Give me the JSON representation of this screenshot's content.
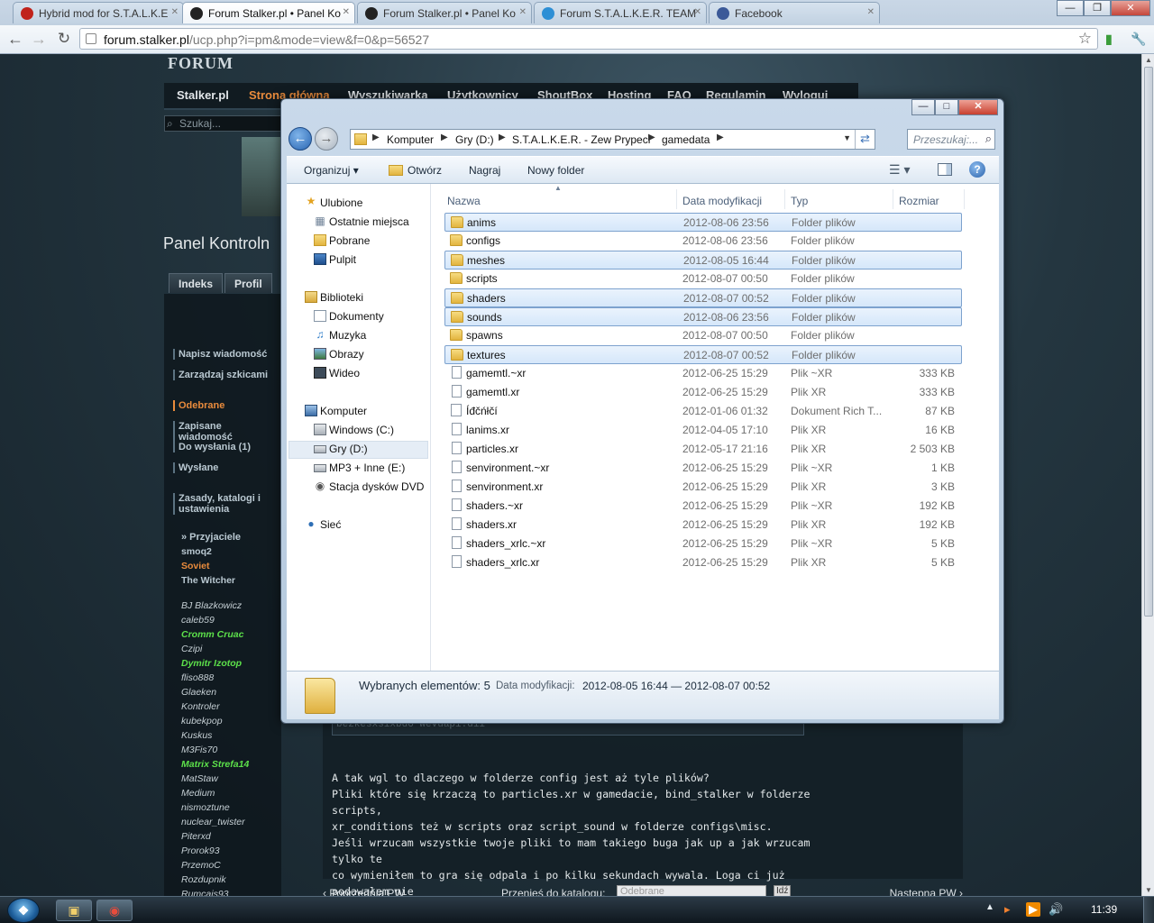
{
  "browser": {
    "tabs": [
      {
        "title": "Hybrid mod for S.T.A.L.K.E",
        "icon": "opera-icon"
      },
      {
        "title": "Forum Stalker.pl • Panel Ko",
        "icon": "radiation-icon",
        "active": true
      },
      {
        "title": "Forum Stalker.pl • Panel Ko",
        "icon": "radiation-icon"
      },
      {
        "title": "Forum S.T.A.L.K.E.R. TEAM",
        "icon": "twitter-bird-icon"
      },
      {
        "title": "Facebook",
        "icon": "facebook-icon"
      }
    ],
    "url_domain": "forum.stalker.pl",
    "url_path": "/ucp.php?i=pm&mode=view&f=0&p=56527"
  },
  "forum": {
    "logo": "FORUM",
    "nav": [
      "Stalker.pl",
      "Strona główna",
      "Wyszukiwarka",
      "Użytkownicy",
      "ShoutBox",
      "Hosting",
      "FAQ",
      "Regulamin",
      "Wyloguj"
    ],
    "search_placeholder": "Szukaj...",
    "panel_title": "Panel Kontroln",
    "tabs": [
      "Indeks",
      "Profil"
    ],
    "menu": [
      "Napisz wiadomość",
      "Zarządzaj szkicami",
      "Odebrane",
      "Zapisane wiadomość",
      "Do wysłania (1)",
      "Wysłane",
      "Zasady, katalogi i ustawienia"
    ],
    "friends_header": "» Przyjaciele",
    "friends_top": [
      "smoq2",
      "Soviet",
      "The Witcher"
    ],
    "friends": [
      "BJ Blazkowicz",
      "caleb59",
      "Cromm Cruac",
      "Czipi",
      "Dymitr Izotop",
      "fliso888",
      "Glaeken",
      "Kontroler",
      "kubekpop",
      "Kuskus",
      "M3Fis70",
      "Matrix Strefa14",
      "MatStaw",
      "Medium",
      "nismoztune",
      "nuclear_twister",
      "Piterxd",
      "Prorok93",
      "PrzemoC",
      "Rozdupnik",
      "Rumcajs93"
    ],
    "code_snippet": "bezkesxsixbdo wevuapi.dii",
    "post_lines": [
      "A tak wgl to dlaczego w folderze config jest aż tyle plików?",
      "Pliki które się krzaczą to particles.xr w gamedacie, bind_stalker w folderze scripts,",
      "xr_conditions też w scripts oraz script_sound w folderze configs\\misc.",
      "Jeśli wrzucam wszystkie twoje pliki to mam takiego buga jak up a jak wrzucam tylko te",
      "co wymieniłem to gra się odpala i po kilku sekundach wywala. Loga ci już podawałem nie",
      "mamm go teraz bo aktualnie wywala mi błąd z dźwiękiem broni."
    ],
    "bottom_prev": "‹ Poprzednia PW",
    "bottom_move": "Przenieś do katalogu:",
    "bottom_select": "Odebrane",
    "bottom_go": "Idź",
    "bottom_next": "Następna PW ›"
  },
  "explorer": {
    "breadcrumbs": [
      "Komputer",
      "Gry (D:)",
      "S.T.A.L.K.E.R. - Zew Prypeci",
      "gamedata"
    ],
    "search_placeholder": "Przeszukaj:...",
    "commands": {
      "organize": "Organizuj",
      "open": "Otwórz",
      "burn": "Nagraj",
      "new_folder": "Nowy folder"
    },
    "nav": {
      "favorites": "Ulubione",
      "fav_items": [
        "Ostatnie miejsca",
        "Pobrane",
        "Pulpit"
      ],
      "libraries": "Biblioteki",
      "lib_items": [
        "Dokumenty",
        "Muzyka",
        "Obrazy",
        "Wideo"
      ],
      "computer": "Komputer",
      "comp_items": [
        "Windows (C:)",
        "Gry (D:)",
        "MP3 + Inne (E:)",
        "Stacja dysków DVD F"
      ],
      "network": "Sieć"
    },
    "columns": [
      "Nazwa",
      "Data modyfikacji",
      "Typ",
      "Rozmiar"
    ],
    "files": [
      {
        "name": "anims",
        "date": "2012-08-06 23:56",
        "type": "Folder plików",
        "size": "",
        "kind": "folder",
        "selected": true
      },
      {
        "name": "configs",
        "date": "2012-08-06 23:56",
        "type": "Folder plików",
        "size": "",
        "kind": "folder",
        "selected": false
      },
      {
        "name": "meshes",
        "date": "2012-08-05 16:44",
        "type": "Folder plików",
        "size": "",
        "kind": "folder",
        "selected": true
      },
      {
        "name": "scripts",
        "date": "2012-08-07 00:50",
        "type": "Folder plików",
        "size": "",
        "kind": "folder",
        "selected": false
      },
      {
        "name": "shaders",
        "date": "2012-08-07 00:52",
        "type": "Folder plików",
        "size": "",
        "kind": "folder",
        "selected": true
      },
      {
        "name": "sounds",
        "date": "2012-08-06 23:56",
        "type": "Folder plików",
        "size": "",
        "kind": "folder",
        "selected": true
      },
      {
        "name": "spawns",
        "date": "2012-08-07 00:50",
        "type": "Folder plików",
        "size": "",
        "kind": "folder",
        "selected": false
      },
      {
        "name": "textures",
        "date": "2012-08-07 00:52",
        "type": "Folder plików",
        "size": "",
        "kind": "folder",
        "selected": true
      },
      {
        "name": "gamemtl.~xr",
        "date": "2012-06-25 15:29",
        "type": "Plik ~XR",
        "size": "333 KB",
        "kind": "file",
        "selected": false
      },
      {
        "name": "gamemtl.xr",
        "date": "2012-06-25 15:29",
        "type": "Plik XR",
        "size": "333 KB",
        "kind": "file",
        "selected": false
      },
      {
        "name": "Íđčńłčí",
        "date": "2012-01-06 01:32",
        "type": "Dokument Rich T...",
        "size": "87 KB",
        "kind": "doc",
        "selected": false
      },
      {
        "name": "lanims.xr",
        "date": "2012-04-05 17:10",
        "type": "Plik XR",
        "size": "16 KB",
        "kind": "file",
        "selected": false
      },
      {
        "name": "particles.xr",
        "date": "2012-05-17 21:16",
        "type": "Plik XR",
        "size": "2 503 KB",
        "kind": "file",
        "selected": false
      },
      {
        "name": "senvironment.~xr",
        "date": "2012-06-25 15:29",
        "type": "Plik ~XR",
        "size": "1 KB",
        "kind": "file",
        "selected": false
      },
      {
        "name": "senvironment.xr",
        "date": "2012-06-25 15:29",
        "type": "Plik XR",
        "size": "3 KB",
        "kind": "file",
        "selected": false
      },
      {
        "name": "shaders.~xr",
        "date": "2012-06-25 15:29",
        "type": "Plik ~XR",
        "size": "192 KB",
        "kind": "file",
        "selected": false
      },
      {
        "name": "shaders.xr",
        "date": "2012-06-25 15:29",
        "type": "Plik XR",
        "size": "192 KB",
        "kind": "file",
        "selected": false
      },
      {
        "name": "shaders_xrlc.~xr",
        "date": "2012-06-25 15:29",
        "type": "Plik ~XR",
        "size": "5 KB",
        "kind": "file",
        "selected": false
      },
      {
        "name": "shaders_xrlc.xr",
        "date": "2012-06-25 15:29",
        "type": "Plik XR",
        "size": "5 KB",
        "kind": "file",
        "selected": false
      }
    ],
    "details": {
      "selected": "Wybranych elementów: 5",
      "date_label": "Data modyfikacji:",
      "date_value": "2012-08-05 16:44 — 2012-08-07 00:52"
    }
  },
  "taskbar": {
    "clock": "11:39"
  }
}
